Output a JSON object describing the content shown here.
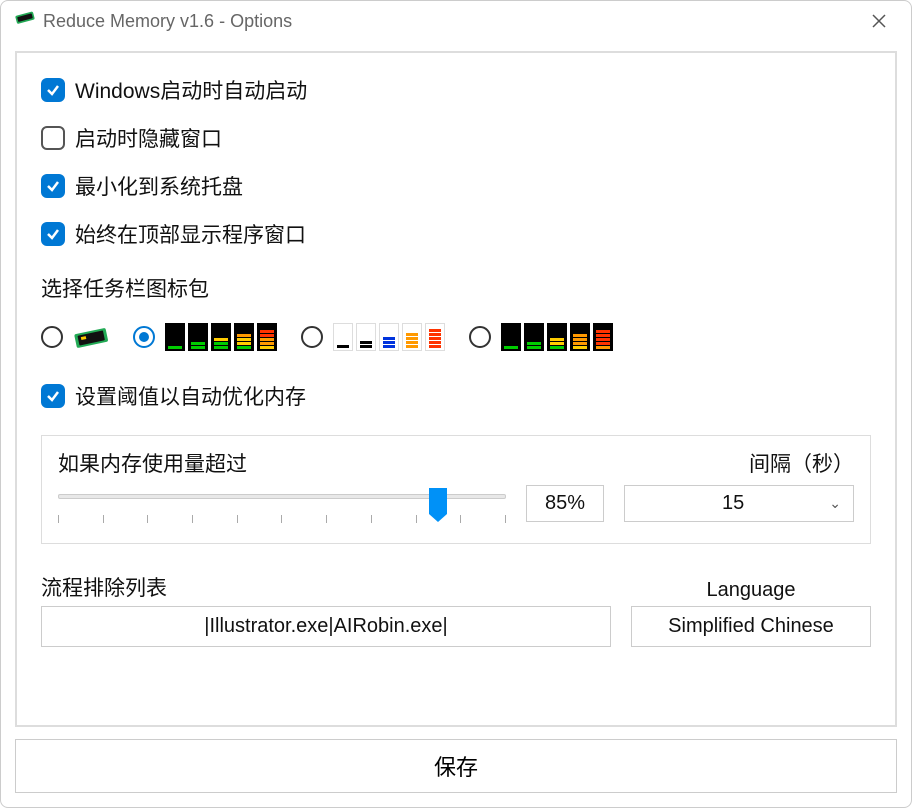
{
  "window": {
    "title": "Reduce Memory v1.6 - Options"
  },
  "options": {
    "autostart": {
      "label": "Windows启动时自动启动",
      "checked": true
    },
    "hide_on_start": {
      "label": "启动时隐藏窗口",
      "checked": false
    },
    "minimize_tray": {
      "label": "最小化到系统托盘",
      "checked": true
    },
    "always_on_top": {
      "label": "始终在顶部显示程序窗口",
      "checked": true
    }
  },
  "iconpack": {
    "label": "选择任务栏图标包",
    "selected_index": 1,
    "packs": [
      "chip",
      "bars-black",
      "bars-white",
      "bars-black-2"
    ]
  },
  "threshold": {
    "enable_label": "设置阈值以自动优化内存",
    "enable_checked": true,
    "mem_label": "如果内存使用量超过",
    "interval_label": "间隔（秒）",
    "percent": "85%",
    "interval_value": "15",
    "slider_value": 85
  },
  "exclude": {
    "label": "流程排除列表",
    "value": "|Illustrator.exe|AIRobin.exe|"
  },
  "language": {
    "label": "Language",
    "value": "Simplified Chinese"
  },
  "save_label": "保存"
}
